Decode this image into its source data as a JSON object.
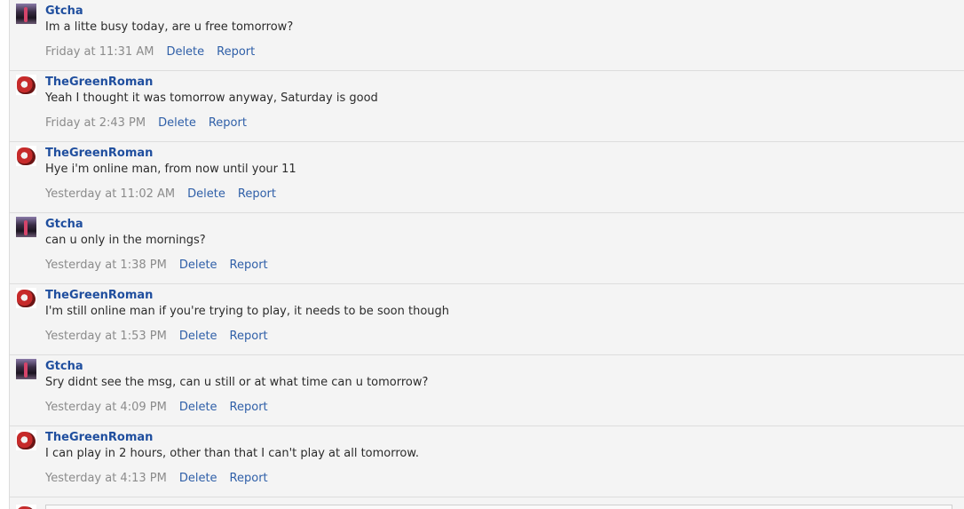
{
  "messages": [
    {
      "author": "Gtcha",
      "avatar": "gtcha",
      "text": "Im a litte busy today, are u free tomorrow?",
      "time": "Friday at 11:31 AM",
      "delete": "Delete",
      "report": "Report"
    },
    {
      "author": "TheGreenRoman",
      "avatar": "roman",
      "text": "Yeah I thought it was tomorrow anyway, Saturday is good",
      "time": "Friday at 2:43 PM",
      "delete": "Delete",
      "report": "Report"
    },
    {
      "author": "TheGreenRoman",
      "avatar": "roman",
      "text": "Hye i'm online man, from now until your 11",
      "time": "Yesterday at 11:02 AM",
      "delete": "Delete",
      "report": "Report"
    },
    {
      "author": "Gtcha",
      "avatar": "gtcha",
      "text": "can u only in the mornings?",
      "time": "Yesterday at 1:38 PM",
      "delete": "Delete",
      "report": "Report"
    },
    {
      "author": "TheGreenRoman",
      "avatar": "roman",
      "text": "I'm still online man if you're trying to play, it needs to be soon though",
      "time": "Yesterday at 1:53 PM",
      "delete": "Delete",
      "report": "Report"
    },
    {
      "author": "Gtcha",
      "avatar": "gtcha",
      "text": "Sry didnt see the msg, can u still or at what time can u tomorrow?",
      "time": "Yesterday at 4:09 PM",
      "delete": "Delete",
      "report": "Report"
    },
    {
      "author": "TheGreenRoman",
      "avatar": "roman",
      "text": "I can play in 2 hours, other than that I can't play at all tomorrow.",
      "time": "Yesterday at 4:13 PM",
      "delete": "Delete",
      "report": "Report"
    }
  ]
}
